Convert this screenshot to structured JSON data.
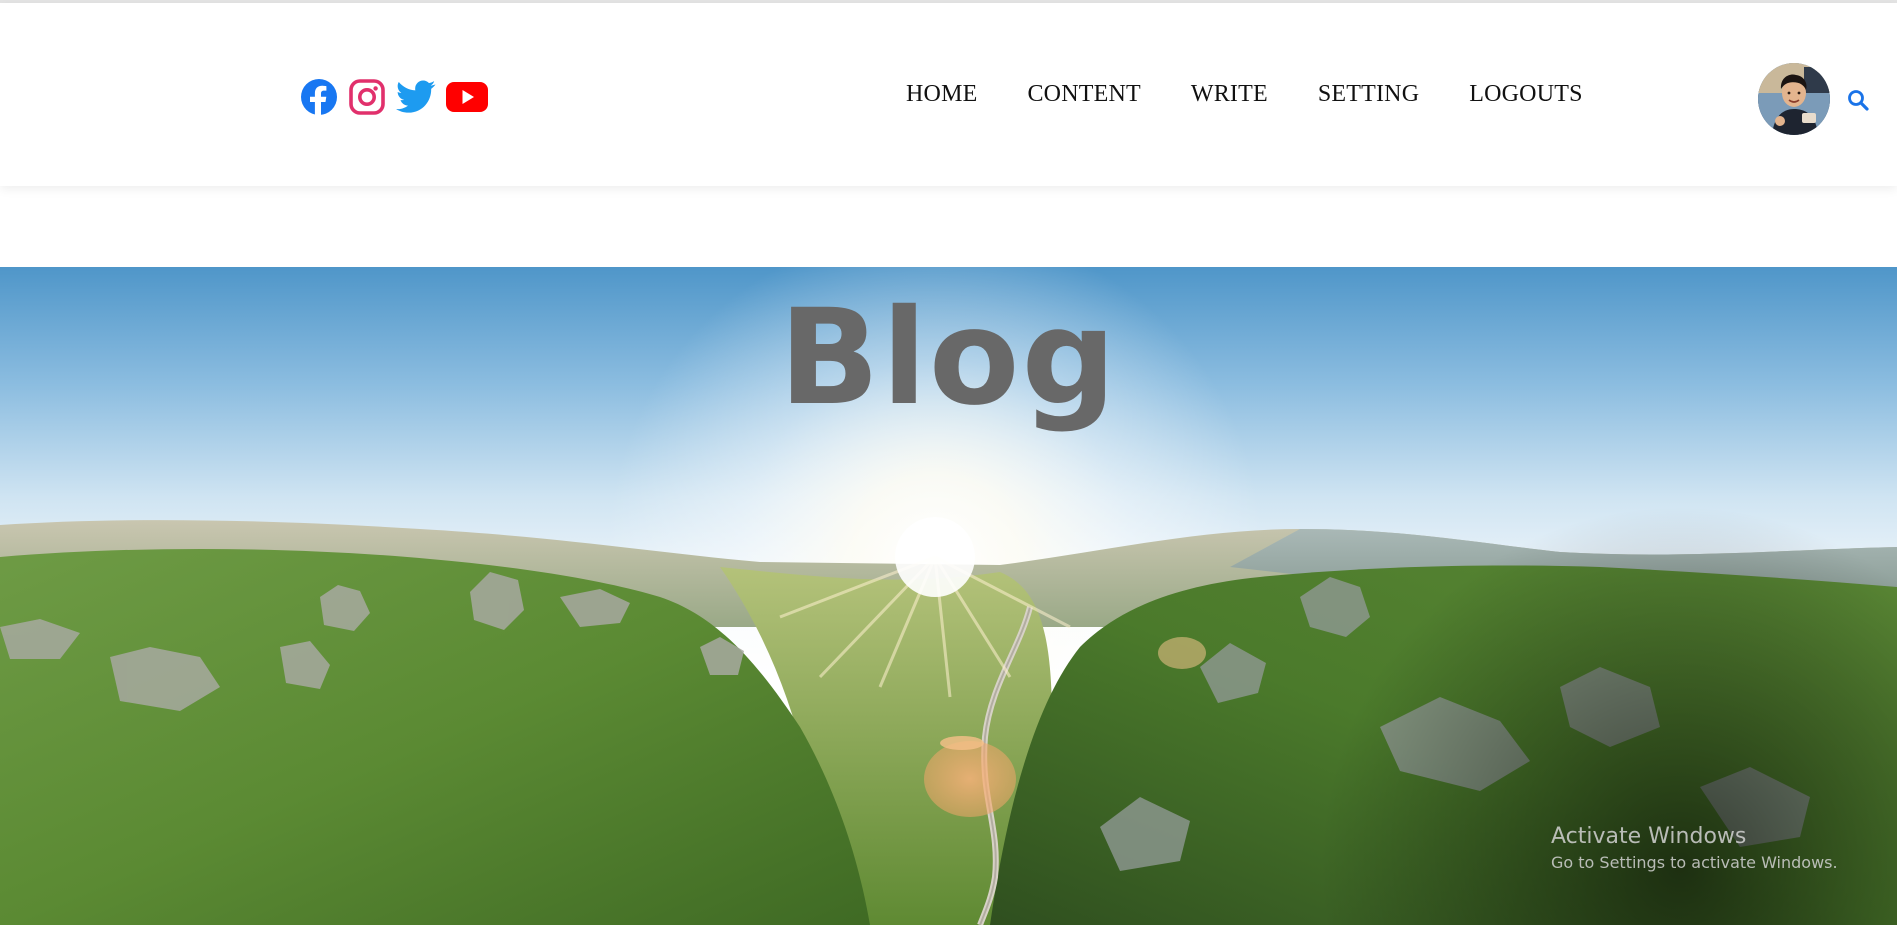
{
  "social": [
    {
      "name": "facebook-icon",
      "color": "#1877f2"
    },
    {
      "name": "instagram-icon",
      "color": "#e1306c"
    },
    {
      "name": "twitter-icon",
      "color": "#1d9bf0"
    },
    {
      "name": "youtube-icon",
      "color": "#ff0000"
    }
  ],
  "nav": {
    "items": [
      "HOME",
      "CONTENT",
      "WRITE",
      "SETTING",
      "LOGOUTS"
    ]
  },
  "header": {
    "avatar_icon": "user-avatar",
    "search_icon": "search-icon",
    "search_color": "#1a73e8"
  },
  "hero": {
    "title": "Blog",
    "image": "green-hills-sunrise-landscape"
  },
  "watermark": {
    "title": "Activate Windows",
    "subtitle": "Go to Settings to activate Windows."
  }
}
